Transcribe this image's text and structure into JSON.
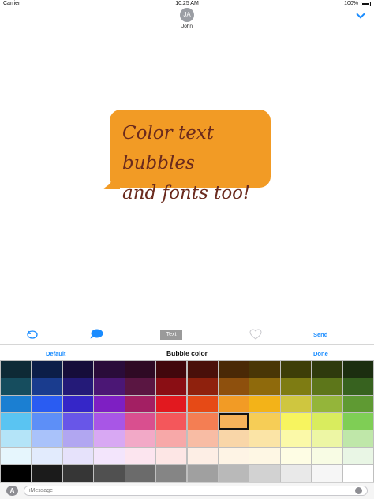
{
  "status_bar": {
    "carrier": "Carrier",
    "time": "10:25 AM",
    "battery": "100%"
  },
  "header": {
    "avatar_initials": "JA",
    "contact_name": "John"
  },
  "bubble": {
    "lines": [
      "Color text bubbles",
      "and fonts too!"
    ],
    "color": "#f29b25",
    "text_color": "#6a2a1d"
  },
  "toolbar": {
    "text_label": "Text",
    "send_label": "Send",
    "icons": [
      "undo-icon",
      "speech-bubble-icon",
      "heart-icon"
    ]
  },
  "panel": {
    "default_label": "Default",
    "title": "Bubble color",
    "done_label": "Done"
  },
  "palette": {
    "selected": [
      3,
      7
    ],
    "rows": [
      [
        "#0e2a36",
        "#0c1e48",
        "#160d3a",
        "#2a0c3a",
        "#2f0a24",
        "#42070c",
        "#4a100a",
        "#4a2906",
        "#4a3606",
        "#3e3e08",
        "#2f3a0d",
        "#1c2e10"
      ],
      [
        "#164d5e",
        "#1a3c8e",
        "#241a78",
        "#4b1775",
        "#5a1642",
        "#8a0e14",
        "#8f210d",
        "#8e500d",
        "#8f6a0c",
        "#7e7c13",
        "#5d761a",
        "#37621f"
      ],
      [
        "#1b7fd2",
        "#2a5cf2",
        "#3526c8",
        "#7e1fc3",
        "#a31f63",
        "#e2191f",
        "#e64a16",
        "#f29b25",
        "#f3b318",
        "#cfc63f",
        "#94b53a",
        "#5f9a33"
      ],
      [
        "#5ac4f2",
        "#5d8ff7",
        "#6856e8",
        "#a856e6",
        "#d94f8f",
        "#f4575b",
        "#f47e53",
        "#f5b25a",
        "#f6cd56",
        "#f7f45f",
        "#d9ec5e",
        "#7fce55"
      ],
      [
        "#b4e4f8",
        "#a9c2fa",
        "#b1a6f1",
        "#d8a8f3",
        "#f2a9c7",
        "#f7a8a8",
        "#f8bca4",
        "#f9d6a8",
        "#fbe4a6",
        "#fbf9a8",
        "#edf6a4",
        "#bfe7a9"
      ],
      [
        "#e6f6fd",
        "#e2ebfd",
        "#e6e2fb",
        "#f3e5fc",
        "#fce5ef",
        "#fde6e5",
        "#fdeee5",
        "#fef4e5",
        "#fef7e4",
        "#fefde4",
        "#f8fce4",
        "#e9f6e5"
      ],
      [
        "#000000",
        "#1b1b1b",
        "#363636",
        "#505050",
        "#6b6b6b",
        "#858585",
        "#a0a0a0",
        "#b9b9b9",
        "#d2d2d2",
        "#e9e9e9",
        "#f6f6f6",
        "#ffffff"
      ]
    ]
  },
  "input": {
    "placeholder": "iMessage",
    "apps_glyph": "A"
  }
}
